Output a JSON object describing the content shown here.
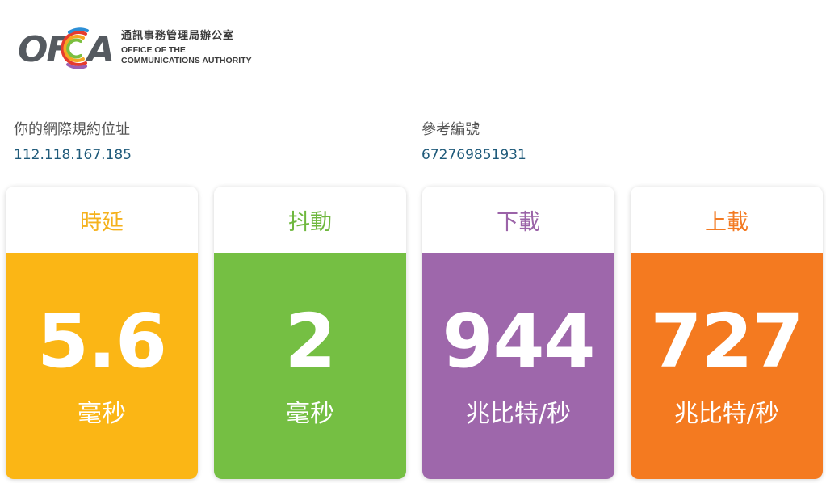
{
  "logo": {
    "text_left": "OF",
    "text_right": "A",
    "name_cn": "通訊事務管理局辦公室",
    "name_en_line1": "OFFICE OF THE",
    "name_en_line2": "COMMUNICATIONS AUTHORITY",
    "arc_colors": [
      "#e63b2e",
      "#f5a623",
      "#7bbf3f",
      "#2c8fd6",
      "#9b5fb2"
    ]
  },
  "info": {
    "ip_label": "你的網際規約位址",
    "ip_value": "112.118.167.185",
    "ref_label": "參考編號",
    "ref_value": "672769851931"
  },
  "cards": [
    {
      "title": "時延",
      "value": "5.6",
      "unit": "毫秒",
      "color": "#fbb615",
      "title_color": "#f5b21d"
    },
    {
      "title": "抖動",
      "value": "2",
      "unit": "毫秒",
      "color": "#75bf43",
      "title_color": "#6fb83e"
    },
    {
      "title": "下載",
      "value": "944",
      "unit": "兆比特/秒",
      "color": "#9e67ab",
      "title_color": "#9b63a8"
    },
    {
      "title": "上載",
      "value": "727",
      "unit": "兆比特/秒",
      "color": "#f47a20",
      "title_color": "#f37a22"
    }
  ]
}
